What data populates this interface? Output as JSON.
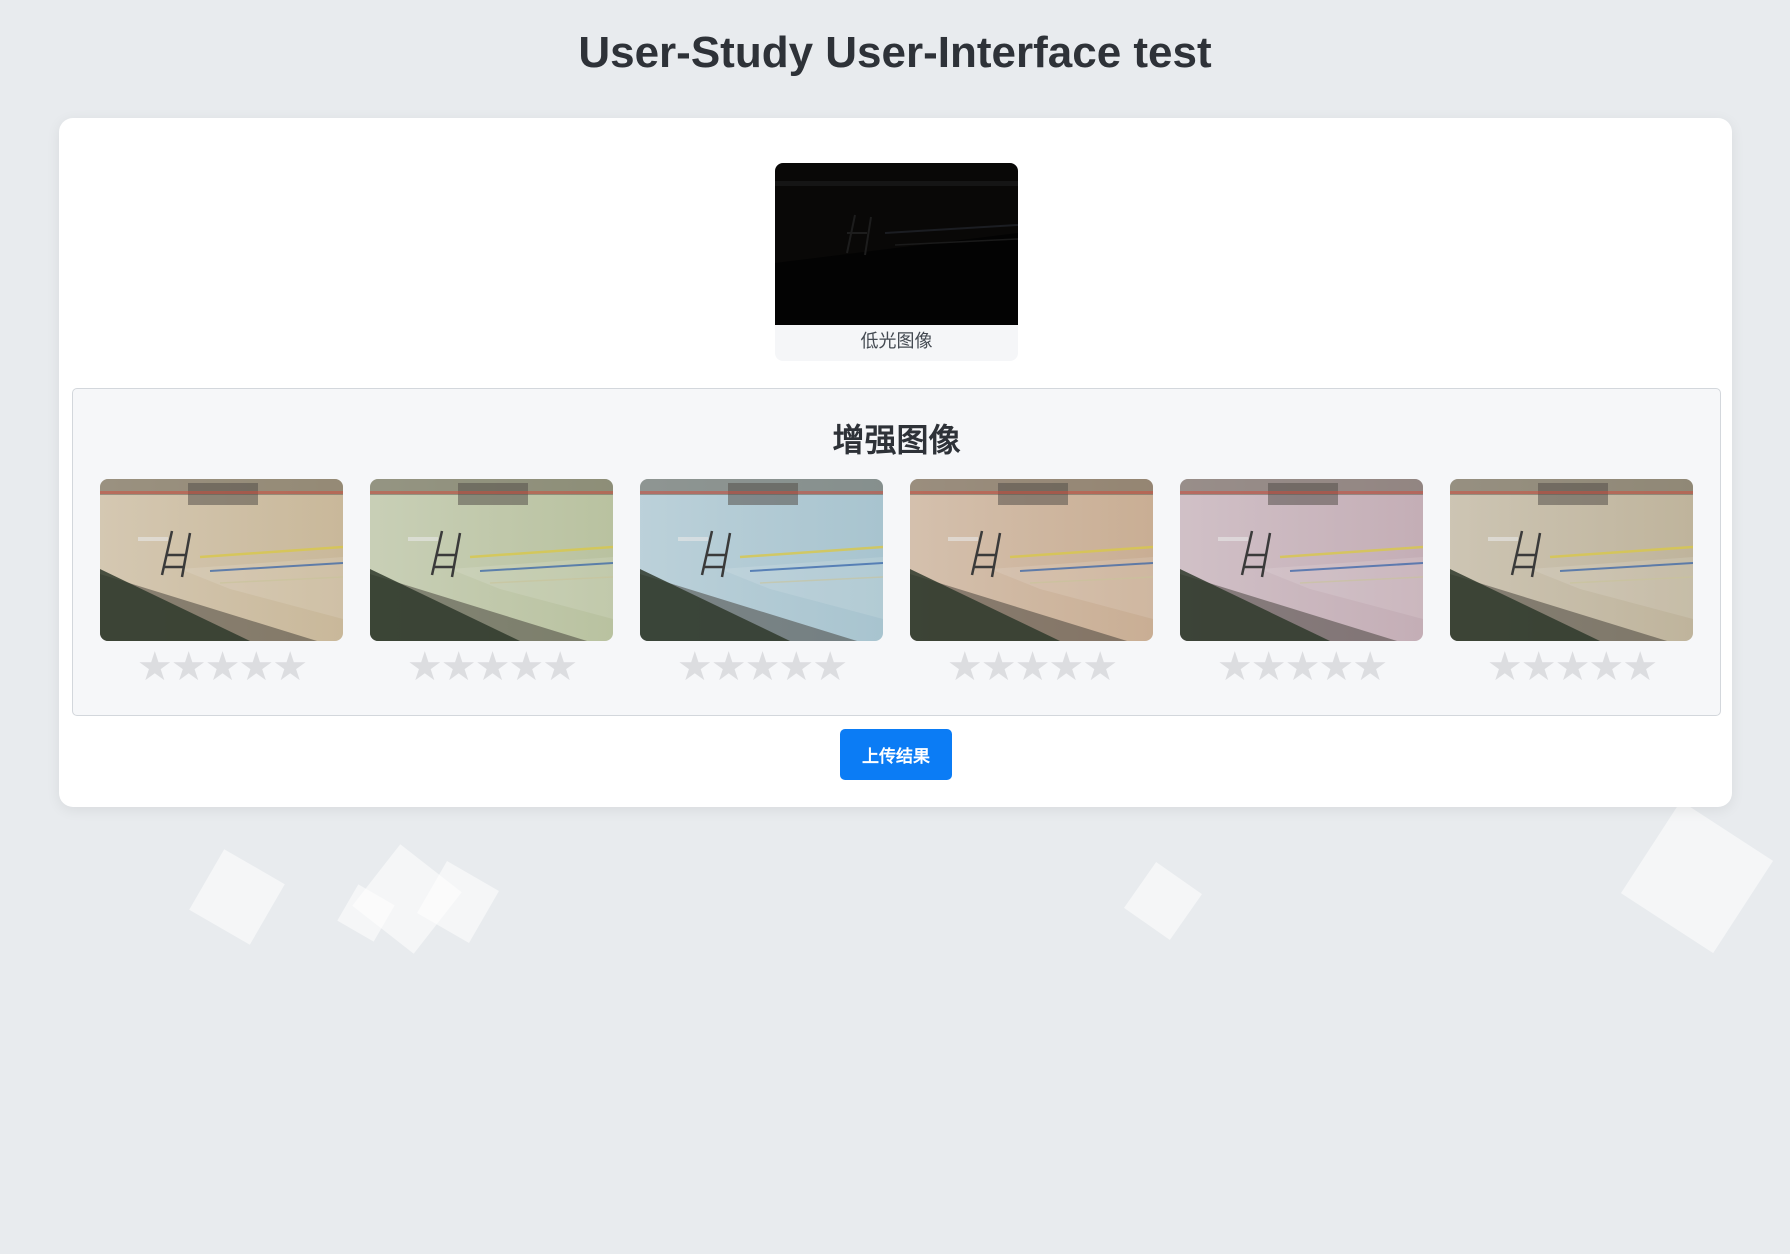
{
  "page": {
    "title": "User-Study User-Interface test"
  },
  "lowlight": {
    "caption": "低光图像"
  },
  "enhanced": {
    "title": "增强图像",
    "items": [
      {
        "rating": 0,
        "max_rating": 5,
        "tint": "#c9b89a"
      },
      {
        "rating": 0,
        "max_rating": 5,
        "tint": "#b9c2a0"
      },
      {
        "rating": 0,
        "max_rating": 5,
        "tint": "#a8c4cf"
      },
      {
        "rating": 0,
        "max_rating": 5,
        "tint": "#c9ae94"
      },
      {
        "rating": 0,
        "max_rating": 5,
        "tint": "#c4aeb6"
      },
      {
        "rating": 0,
        "max_rating": 5,
        "tint": "#bfb49c"
      }
    ]
  },
  "actions": {
    "upload_label": "上传结果"
  },
  "colors": {
    "accent": "#0b7cf5",
    "star_empty": "#dcdde0",
    "background": "#e8ebee"
  },
  "icons": {
    "star": "star-icon"
  }
}
